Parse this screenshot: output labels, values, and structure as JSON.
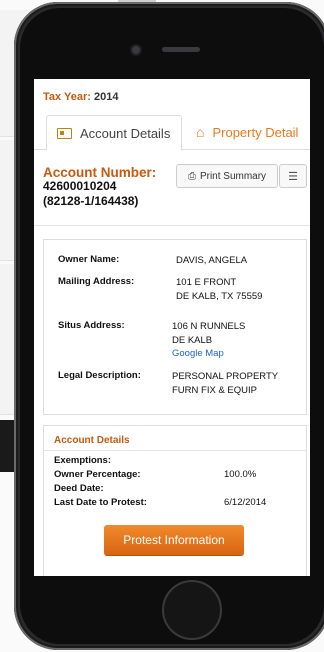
{
  "header": {
    "tax_year_label": "Tax Year:",
    "tax_year_value": "2014"
  },
  "tabs": [
    {
      "label": "Account Details",
      "icon": "id-card-icon",
      "active": true
    },
    {
      "label": "Property Detail",
      "icon": "home-icon",
      "active": false
    }
  ],
  "account": {
    "label": "Account Number:",
    "number": "42600010204",
    "sub": "(82128-1/164438)",
    "print_label": "Print Summary"
  },
  "owner": {
    "owner_name_label": "Owner Name:",
    "owner_name": "DAVIS, ANGELA",
    "mailing_label": "Mailing Address:",
    "mailing_line1": "101 E FRONT",
    "mailing_line2": "DE KALB, TX 75559",
    "situs_label": "Situs Address:",
    "situs_line1": "106 N RUNNELS",
    "situs_line2": "DE KALB",
    "map_link": "Google Map",
    "legal_label": "Legal Description:",
    "legal_line1": "PERSONAL PROPERTY",
    "legal_line2": "FURN FIX & EQUIP"
  },
  "details": {
    "title": "Account Details",
    "exemptions_label": "Exemptions:",
    "exemptions_value": "",
    "owner_pct_label": "Owner Percentage:",
    "owner_pct_value": "100.0%",
    "deed_date_label": "Deed Date:",
    "deed_date_value": "",
    "last_protest_label": "Last Date to Protest:",
    "last_protest_value": "6/12/2014",
    "protest_button": "Protest Information"
  },
  "colors": {
    "accent": "#c55a11",
    "button": "#e8771c",
    "link": "#1f64c0"
  }
}
